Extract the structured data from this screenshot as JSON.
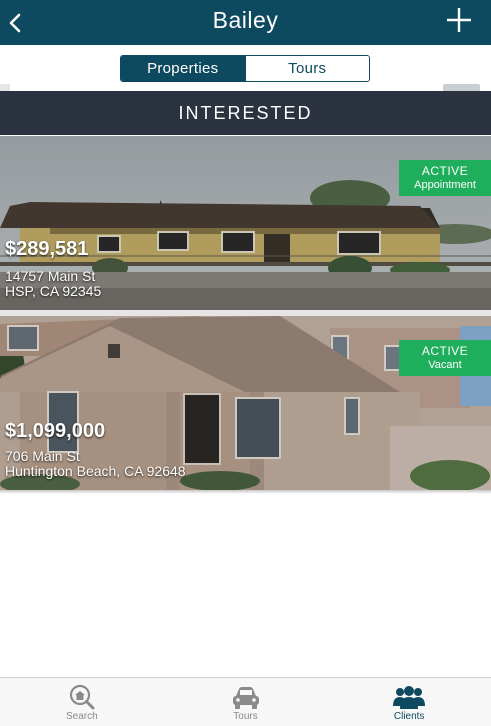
{
  "header": {
    "title": "Bailey",
    "back_icon": "chevron-left-icon",
    "add_icon": "plus-icon"
  },
  "segment": {
    "tabs": [
      {
        "label": "Properties",
        "selected": true
      },
      {
        "label": "Tours",
        "selected": false
      }
    ]
  },
  "section": {
    "title": "INTERESTED"
  },
  "properties": [
    {
      "price": "$289,581",
      "address_line1": "14757 Main St",
      "address_line2": "HSP, CA 92345",
      "status": "ACTIVE",
      "status_detail": "Appointment"
    },
    {
      "price": "$1,099,000",
      "address_line1": "706 Main St",
      "address_line2": "Huntington Beach, CA 92648",
      "status": "ACTIVE",
      "status_detail": "Vacant"
    }
  ],
  "tabbar": {
    "items": [
      {
        "label": "Search",
        "icon": "search-house-icon",
        "active": false
      },
      {
        "label": "Tours",
        "icon": "car-icon",
        "active": false
      },
      {
        "label": "Clients",
        "icon": "people-icon",
        "active": true
      }
    ]
  },
  "colors": {
    "header": "#0e4a5f",
    "section_bar": "#2b3340",
    "status_badge": "#1fae5c"
  }
}
